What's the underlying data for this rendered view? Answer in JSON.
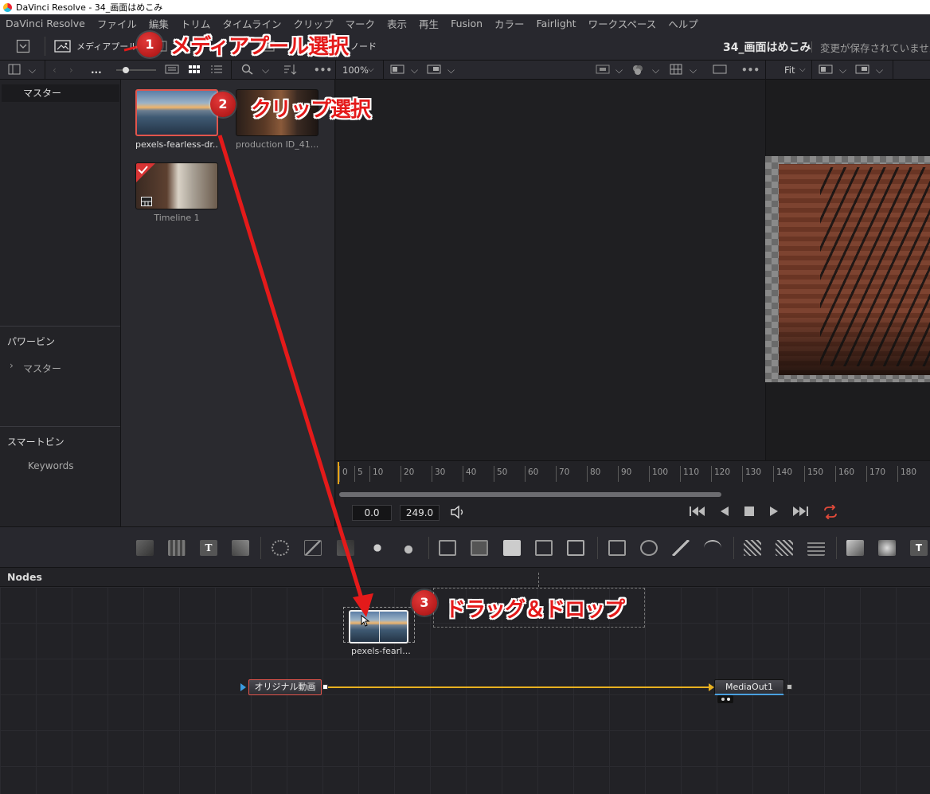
{
  "window": {
    "title": "DaVinci Resolve - 34_画面はめこみ"
  },
  "menu": [
    "DaVinci Resolve",
    "ファイル",
    "編集",
    "トリム",
    "タイムライン",
    "クリップ",
    "マーク",
    "表示",
    "再生",
    "Fusion",
    "カラー",
    "Fairlight",
    "ワークスペース",
    "ヘルプ"
  ],
  "toolbar": {
    "media_pool": "メディアプール",
    "nodes": "ノード",
    "project_title": "34_画面はめこみ",
    "save_status": "変更が保存されていません"
  },
  "subtoolbar": {
    "path": "...",
    "zoom": "100%",
    "fit": "Fit"
  },
  "bins": {
    "master": "マスター",
    "power_bins": "パワービン",
    "power_master": "マスター",
    "smart_bins": "スマートビン",
    "keywords": "Keywords"
  },
  "clips": [
    {
      "name": "pexels-fearless-dr...",
      "selected": true
    },
    {
      "name": "production ID_41...",
      "selected": false
    },
    {
      "name": "Timeline 1",
      "selected": false
    }
  ],
  "ruler": {
    "ticks": [
      "0",
      "5",
      "10",
      "20",
      "30",
      "40",
      "50",
      "60",
      "70",
      "80",
      "90",
      "100",
      "110",
      "120",
      "130",
      "140",
      "150",
      "160",
      "170",
      "180"
    ]
  },
  "transport": {
    "current": "0.0",
    "end": "249.0"
  },
  "nodes_panel": {
    "title": "Nodes"
  },
  "nodes": {
    "dragged": "pexels-fearl...",
    "input": "オリジナル動画",
    "output": "MediaOut1"
  },
  "annotations": [
    {
      "num": "1",
      "text": "メディアプール選択"
    },
    {
      "num": "2",
      "text": "クリップ選択"
    },
    {
      "num": "3",
      "text": "ドラッグ＆ドロップ"
    }
  ],
  "colors": {
    "annotation": "#e41a1a",
    "selection": "#e2554c",
    "connection": "#e8b020",
    "accent_loop": "#e04a3a"
  }
}
